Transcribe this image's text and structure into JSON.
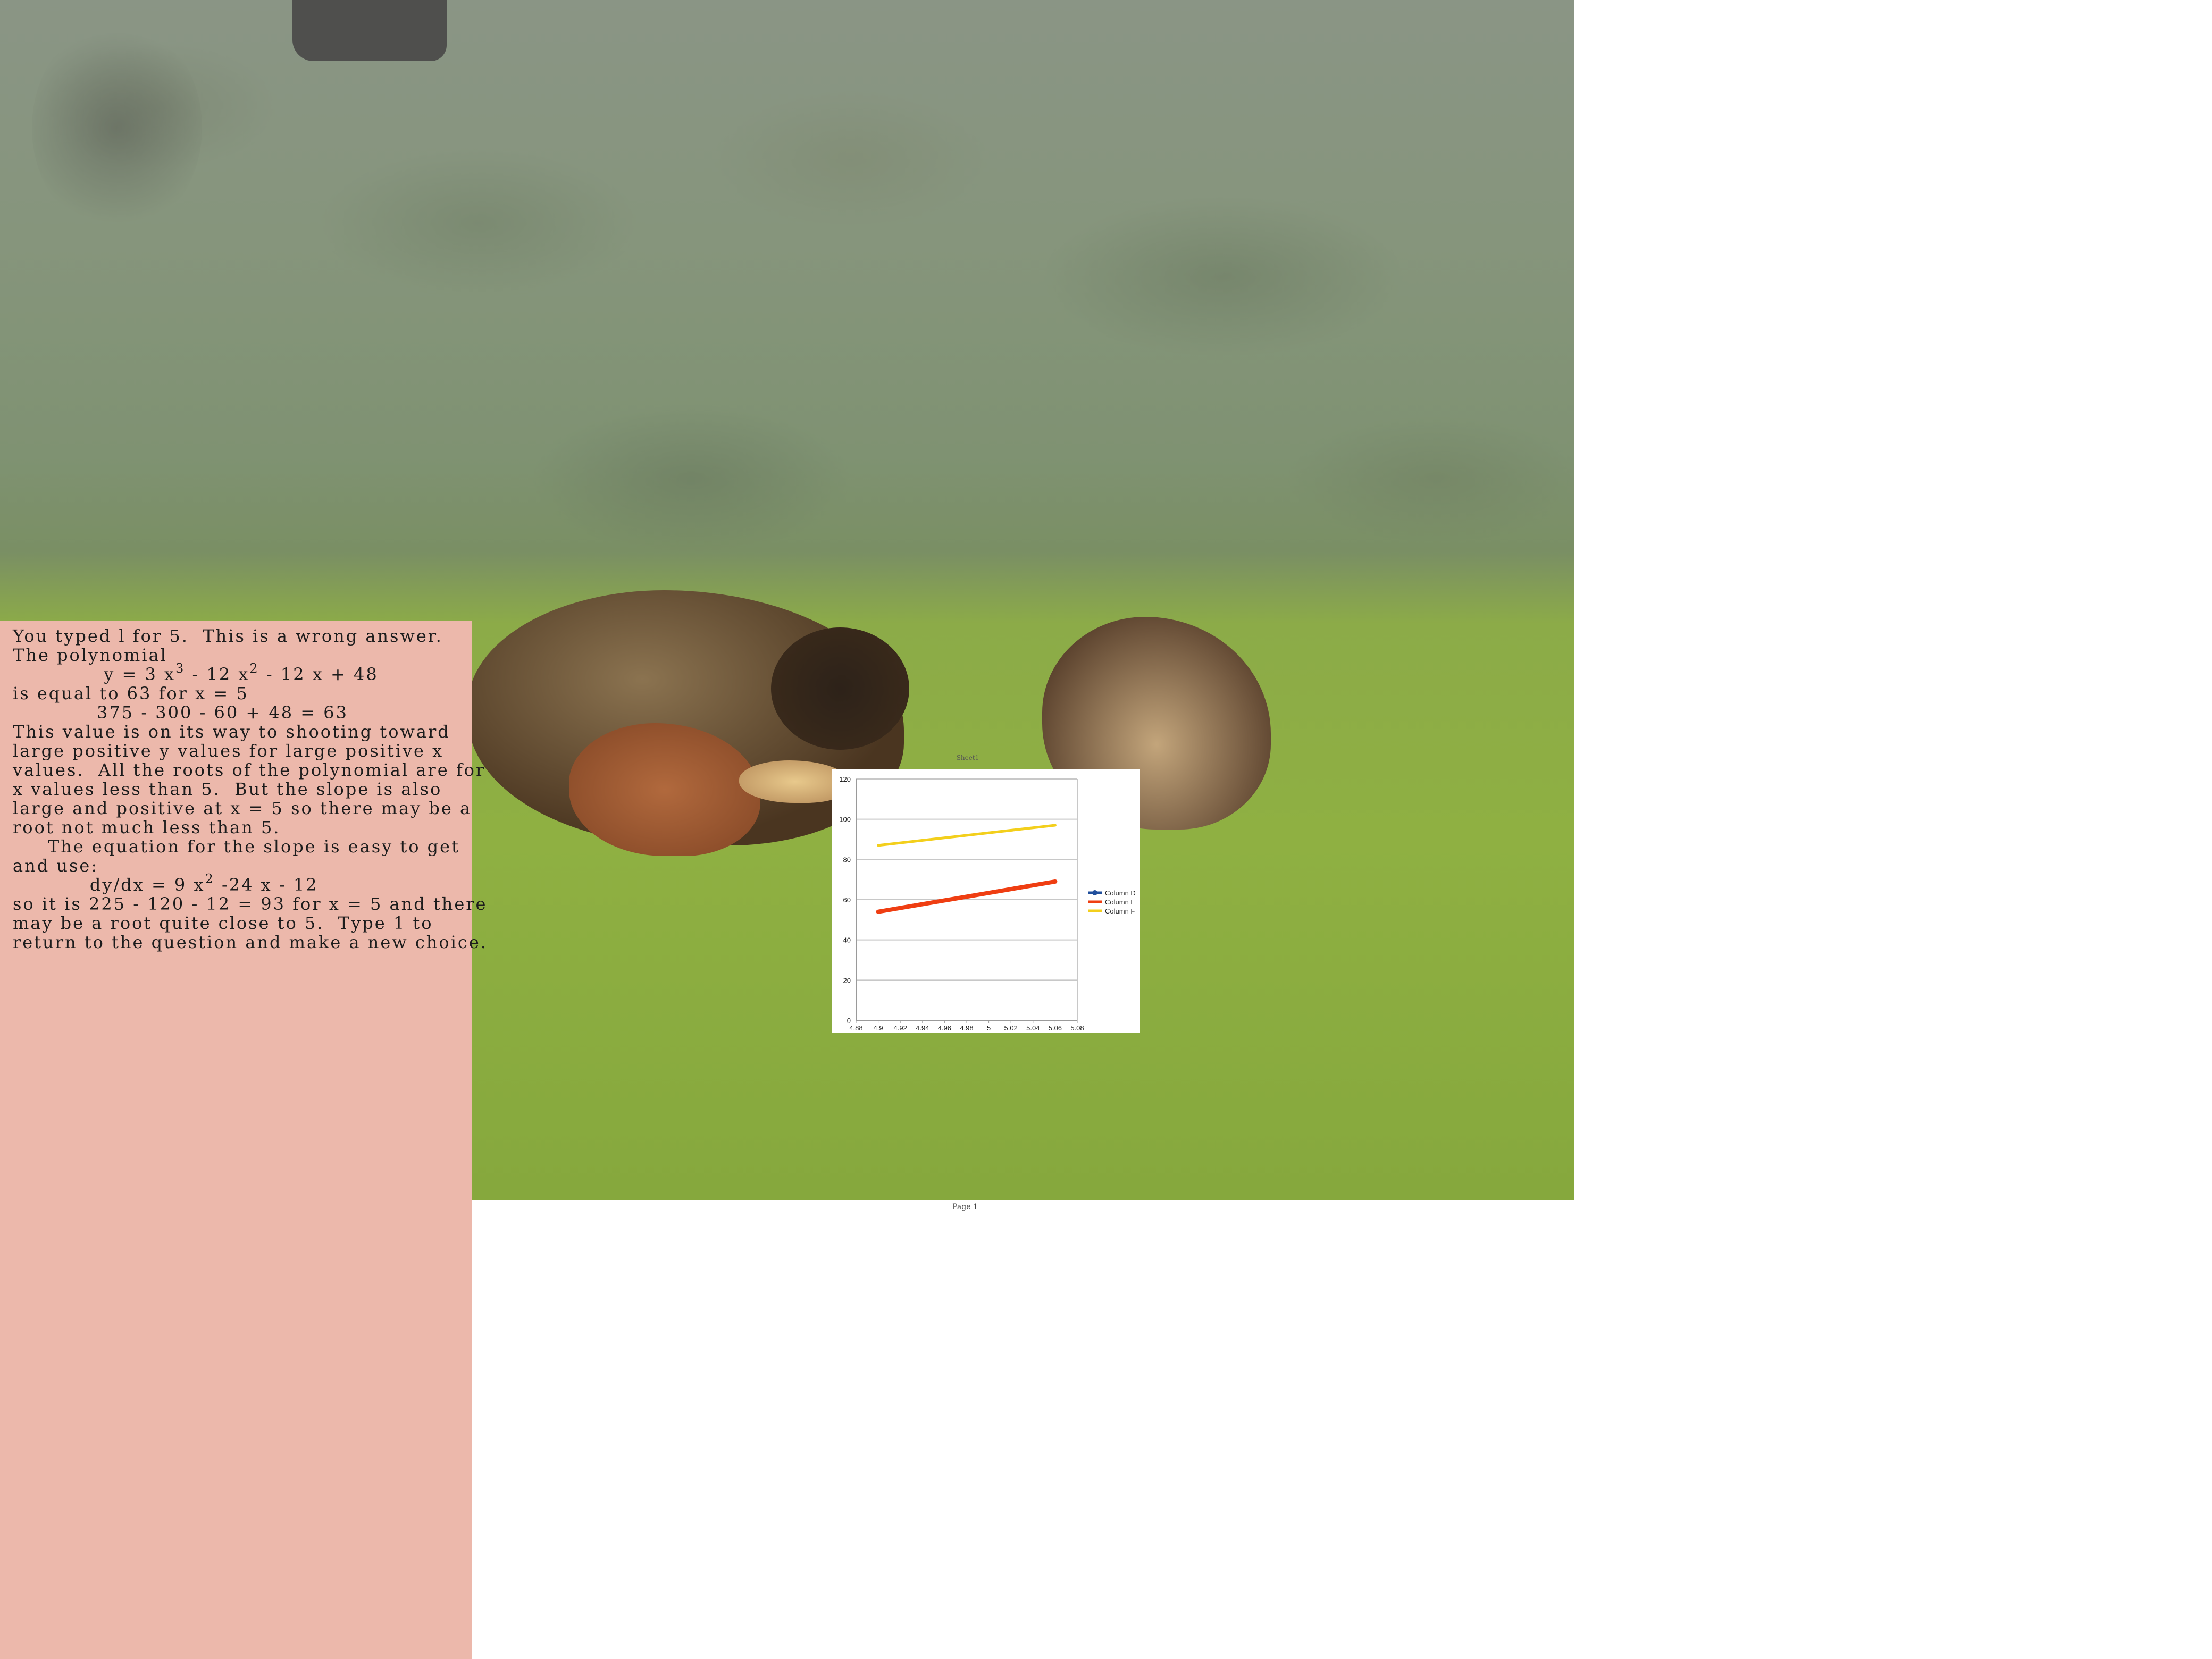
{
  "panel": {
    "lines": [
      "You typed l for 5.  This is a wrong answer.",
      "The polynomial",
      "",
      "is equal to 63 for x = 5",
      "            375 - 300 - 60 + 48 = 63",
      "This value is on its way to shooting toward",
      "large positive y values for large positive x",
      "values.  All the roots of the polynomial are for",
      "x values less than 5.  But the slope is also",
      "large and positive at x = 5 so there may be a",
      "root not much less than 5.",
      "     The equation for the slope is easy to get",
      "and use:",
      "",
      "so it is 225 - 120 - 12 = 93 for x = 5 and there",
      "may be a root quite close to 5.  Type 1 to",
      "return to the question and make a new choice."
    ],
    "poly_a": "             y = 3 x",
    "poly_exp1": "3",
    "poly_b": " - 12 x",
    "poly_exp2": "2",
    "poly_c": " - 12 x + 48",
    "slope_a": "           dy/dx = 9 x",
    "slope_exp": "2",
    "slope_b": " -24 x - 12"
  },
  "chart_sheet_label": "Sheet1",
  "page_footer": "Page 1",
  "chart_data": {
    "type": "line",
    "x": [
      4.9,
      5.06
    ],
    "xticks": [
      "4.88",
      "4.9",
      "4.92",
      "4.94",
      "4.96",
      "4.98",
      "5",
      "5.02",
      "5.04",
      "5.06",
      "5.08"
    ],
    "xlim": [
      4.88,
      5.08
    ],
    "yticks": [
      "0",
      "20",
      "40",
      "60",
      "80",
      "100",
      "120"
    ],
    "ylim": [
      0,
      120
    ],
    "grid": true,
    "legend_position": "right",
    "series": [
      {
        "name": "Column D",
        "values": [],
        "color": "#1f4e9c"
      },
      {
        "name": "Column E",
        "values": [
          54,
          69
        ],
        "color": "#ef3e12"
      },
      {
        "name": "Column F",
        "values": [
          87,
          97
        ],
        "color": "#f3cf1c"
      }
    ]
  }
}
